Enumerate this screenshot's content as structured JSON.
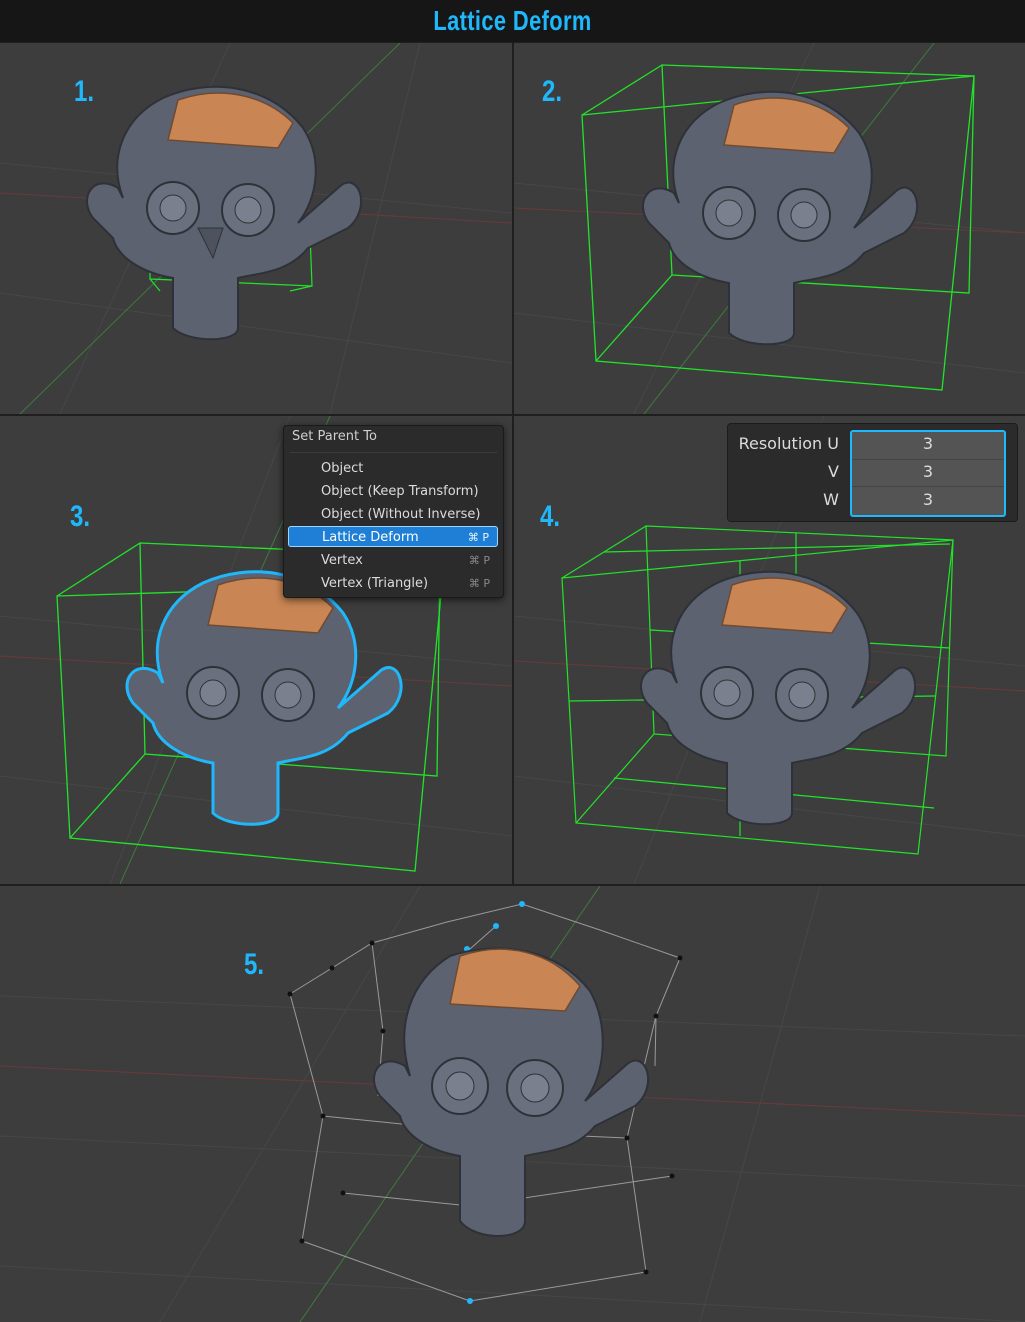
{
  "title": "Lattice Deform",
  "steps": [
    "1.",
    "2.",
    "3.",
    "4.",
    "5."
  ],
  "context_menu": {
    "title": "Set Parent To",
    "items": [
      {
        "label": "Object",
        "shortcut": ""
      },
      {
        "label": "Object (Keep Transform)",
        "shortcut": ""
      },
      {
        "label": "Object (Without Inverse)",
        "shortcut": ""
      },
      {
        "label": "Lattice Deform",
        "shortcut": "⌘ P"
      },
      {
        "label": "Vertex",
        "shortcut": "⌘ P"
      },
      {
        "label": "Vertex (Triangle)",
        "shortcut": "⌘ P"
      }
    ],
    "active_item": "Lattice Deform"
  },
  "resolution": {
    "labels": [
      "Resolution U",
      "V",
      "W"
    ],
    "values": [
      "3",
      "3",
      "3"
    ]
  },
  "colors": {
    "accent": "#1fb8ff",
    "lattice": "#22e32a",
    "outline": "#1fb8ff",
    "viewport": "#3d3d3d"
  }
}
